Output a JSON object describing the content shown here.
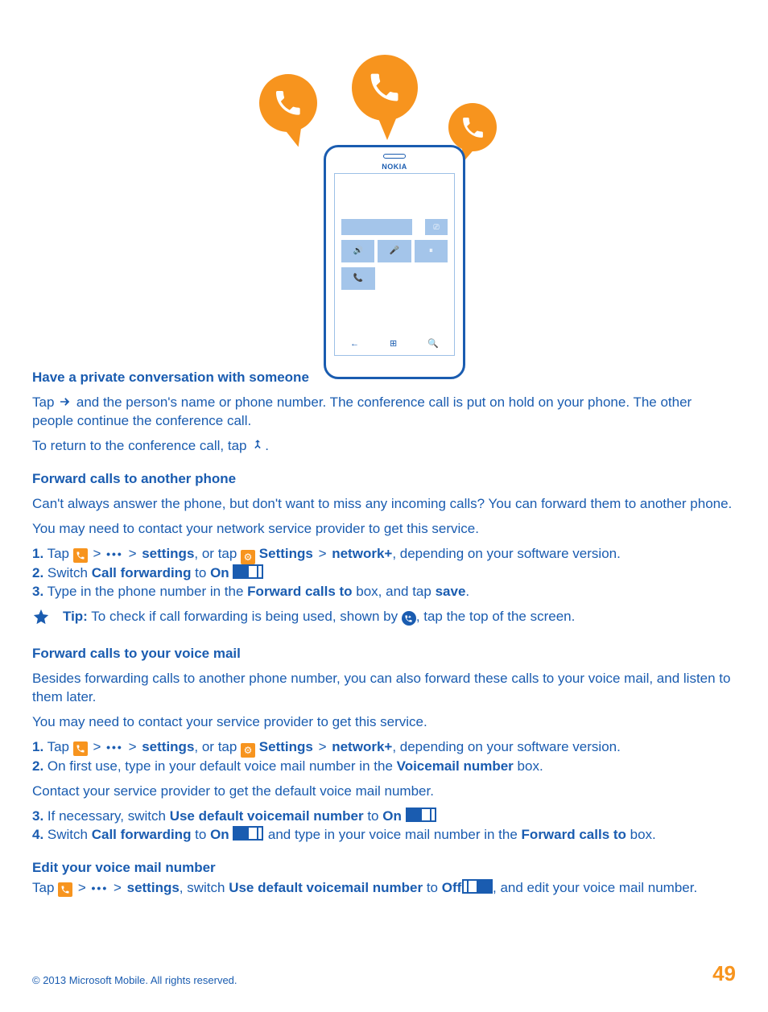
{
  "illustration": {
    "brand": "NOKIA"
  },
  "section1": {
    "heading": "Have a private conversation with someone",
    "p1a": "Tap ",
    "p1b": " and the person's name or phone number. The conference call is put on hold on your phone. The other people continue the conference call.",
    "p2a": "To return to the conference call, tap ",
    "p2b": "."
  },
  "section2": {
    "heading": "Forward calls to another phone",
    "intro": "Can't always answer the phone, but don't want to miss any incoming calls? You can forward them to another phone.",
    "note": "You may need to contact your network service provider to get this service.",
    "s1_num": "1.",
    "s1_a": " Tap ",
    "s1_b": " > ",
    "s1_c": " > ",
    "s1_settings": "settings",
    "s1_d": ", or tap ",
    "s1_Settings": "Settings",
    "s1_e": " > ",
    "s1_network": "network+",
    "s1_f": ", depending on your software version.",
    "s2_num": "2.",
    "s2_a": " Switch ",
    "s2_cf": "Call forwarding",
    "s2_b": " to ",
    "s2_on": "On",
    "s2_c": " ",
    "s2_d": ".",
    "s3_num": "3.",
    "s3_a": " Type in the phone number in the ",
    "s3_box": "Forward calls to",
    "s3_b": " box, and tap ",
    "s3_save": "save",
    "s3_c": ".",
    "tip_label": "Tip:",
    "tip_a": " To check if call forwarding is being used, shown by ",
    "tip_b": ", tap the top of the screen."
  },
  "section3": {
    "heading": "Forward calls to your voice mail",
    "intro": "Besides forwarding calls to another phone number, you can also forward these calls to your voice mail, and listen to them later.",
    "note": "You may need to contact your service provider to get this service.",
    "s1_num": "1.",
    "s1_a": " Tap ",
    "s1_b": " > ",
    "s1_c": " > ",
    "s1_settings": "settings",
    "s1_d": ", or tap ",
    "s1_Settings": "Settings",
    "s1_e": " > ",
    "s1_network": "network+",
    "s1_f": ", depending on your software version.",
    "s2_num": "2.",
    "s2_a": " On first use, type in your default voice mail number in the ",
    "s2_box": "Voicemail number",
    "s2_b": " box.",
    "contact": "Contact your service provider to get the default voice mail number.",
    "s3_num": "3.",
    "s3_a": " If necessary, switch ",
    "s3_sw": "Use default voicemail number",
    "s3_b": " to ",
    "s3_on": "On",
    "s3_c": " ",
    "s3_d": ".",
    "s4_num": "4.",
    "s4_a": " Switch ",
    "s4_cf": "Call forwarding",
    "s4_b": " to ",
    "s4_on": "On",
    "s4_c": " ",
    "s4_d": ", and type in your voice mail number in the ",
    "s4_box": "Forward calls to",
    "s4_e": " box."
  },
  "section4": {
    "heading": "Edit your voice mail number",
    "a": "Tap ",
    "b": " > ",
    "c": " > ",
    "settings": "settings",
    "d": ", switch ",
    "sw": "Use default voicemail number",
    "e": " to ",
    "off": "Off",
    "f": " ",
    "g": ", and edit your voice mail number."
  },
  "footer": {
    "copyright": "© 2013 Microsoft Mobile. All rights reserved.",
    "page": "49"
  }
}
